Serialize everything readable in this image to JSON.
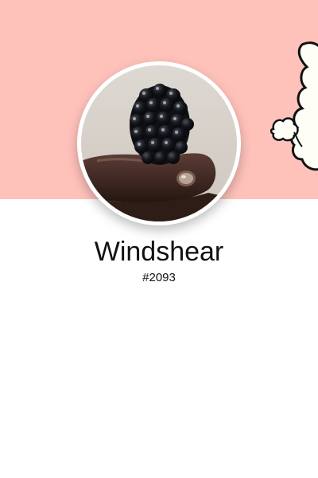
{
  "profile": {
    "name": "Windshear",
    "id": "#2093"
  },
  "header": {
    "banner_color": "#ffc2bb"
  },
  "icons": {
    "banner_art": "cloud-mascot-icon",
    "avatar_image": "frog-with-blackberry-image"
  },
  "colors": {
    "background": "#ffffff",
    "text": "#111111"
  }
}
